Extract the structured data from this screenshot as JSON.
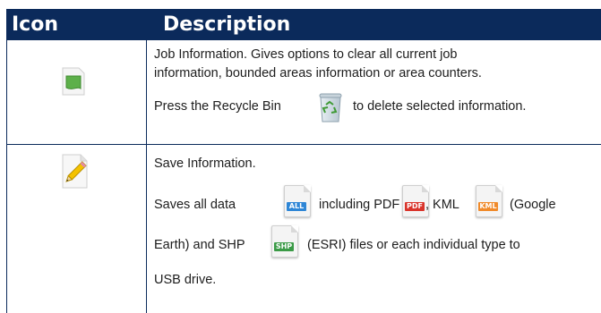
{
  "header": {
    "icon_col": "Icon",
    "description_col": "Description"
  },
  "row1": {
    "line1": "Job Information. Gives options to clear all current job",
    "line2": "information,  bounded areas information or area counters.",
    "line3_before": "Press the Recycle Bin",
    "line3_after": "to delete selected information."
  },
  "row2": {
    "line1": "Save Information.",
    "line2_a": "Saves all data",
    "line2_b": "including PDF",
    "line2_c": ", KML",
    "line2_d": "(Google",
    "line3_a": "Earth) and SHP",
    "line3_b": "(ESRI) files or each individual type to",
    "line4": "USB drive."
  },
  "tags": {
    "all": "ALL",
    "pdf": "PDF",
    "kml": "KML",
    "shp": "SHP"
  },
  "colors": {
    "header_bg": "#0b2a5b",
    "all_tag": "#2e86d6",
    "pdf_tag": "#d9342b",
    "kml_tag": "#f08a2a",
    "shp_tag": "#3a9a46"
  },
  "icons": [
    "job-info-icon",
    "recycle-bin-icon",
    "save-info-icon",
    "all-file-icon",
    "pdf-file-icon",
    "kml-file-icon",
    "shp-file-icon"
  ]
}
